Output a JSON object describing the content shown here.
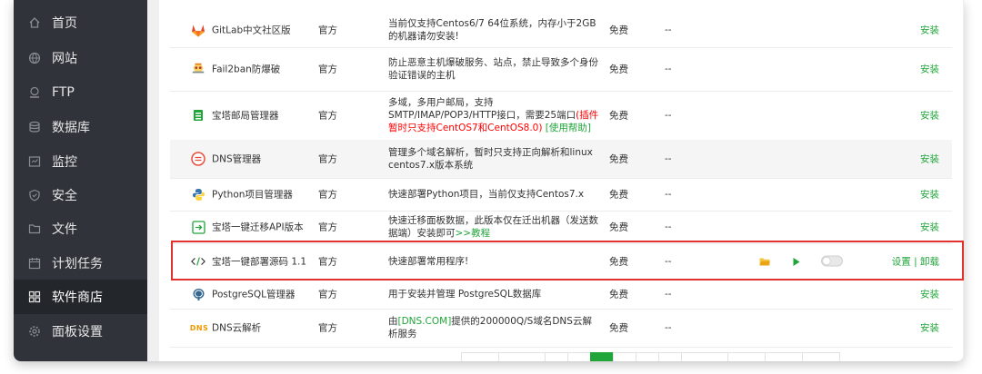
{
  "sidebar": {
    "items": [
      {
        "label": "首页",
        "icon": "home-icon"
      },
      {
        "label": "网站",
        "icon": "globe-icon"
      },
      {
        "label": "FTP",
        "icon": "ftp-icon"
      },
      {
        "label": "数据库",
        "icon": "database-icon"
      },
      {
        "label": "监控",
        "icon": "monitor-icon"
      },
      {
        "label": "安全",
        "icon": "shield-icon"
      },
      {
        "label": "文件",
        "icon": "folder-icon"
      },
      {
        "label": "计划任务",
        "icon": "calendar-icon"
      },
      {
        "label": "软件商店",
        "icon": "grid-icon",
        "active": true
      },
      {
        "label": "面板设置",
        "icon": "gear-icon"
      }
    ]
  },
  "table": {
    "rows": [
      {
        "name": "GitLab中文社区版",
        "type": "官方",
        "desc": "当前仅支持Centos6/7 64位系统，内存小于2GB的机器请勿安装!",
        "price": "免费",
        "expire": "--",
        "action": "安装",
        "icon": "gitlab-icon"
      },
      {
        "name": "Fail2ban防爆破",
        "type": "官方",
        "desc": "防止恶意主机爆破服务、站点，禁止导致多个身份验证错误的主机",
        "price": "免费",
        "expire": "--",
        "action": "安装",
        "icon": "fail2ban-icon"
      },
      {
        "name": "宝塔邮局管理器",
        "type": "官方",
        "desc_a": "多域，多用户邮局，支持SMTP/IMAP/POP3/HTTP接口，需要25端口",
        "desc_red": "(插件暂时只支持CentOS7和CentOS8.0)",
        "desc_link": " [使用帮助]",
        "price": "免费",
        "expire": "--",
        "action": "安装",
        "icon": "mail-server-icon"
      },
      {
        "name": "DNS管理器",
        "type": "官方",
        "desc": "管理多个域名解析，暂时只支持正向解析和linux centos7.x版本系统",
        "price": "免费",
        "expire": "--",
        "action": "安装",
        "icon": "dns-manager-icon"
      },
      {
        "name": "Python项目管理器",
        "type": "官方",
        "desc": "快速部署Python项目，当前仅支持Centos7.x",
        "price": "免费",
        "expire": "--",
        "action": "安装",
        "icon": "python-icon"
      },
      {
        "name": "宝塔一键迁移API版本",
        "type": "官方",
        "desc_a": "快速迁移面板数据，此版本仅在迁出机器（发送数据端）安装即可",
        "desc_link": ">>教程",
        "price": "免费",
        "expire": "--",
        "action": "安装",
        "icon": "migrate-icon"
      },
      {
        "name": "宝塔一键部署源码 1.1",
        "type": "官方",
        "desc": "快速部署常用程序!",
        "price": "免费",
        "expire": "--",
        "action": "设置 | 卸载",
        "icon": "code-icon"
      },
      {
        "name": "PostgreSQL管理器",
        "type": "官方",
        "desc": "用于安装并管理 PostgreSQL数据库",
        "price": "免费",
        "expire": "--",
        "action": "安装",
        "icon": "postgresql-icon"
      },
      {
        "name": "DNS云解析",
        "type": "官方",
        "desc_a": "由",
        "desc_link": "[DNS.COM]",
        "desc_b": "提供的200000Q/S域名DNS云解析服务",
        "price": "免费",
        "expire": "--",
        "action": "安装",
        "icon": "dns-logo-icon",
        "logo_text": "DNS"
      }
    ]
  },
  "colors": {
    "accent": "#20a53a",
    "highlight": "#e0312f",
    "sidebar_bg": "#30333a"
  }
}
